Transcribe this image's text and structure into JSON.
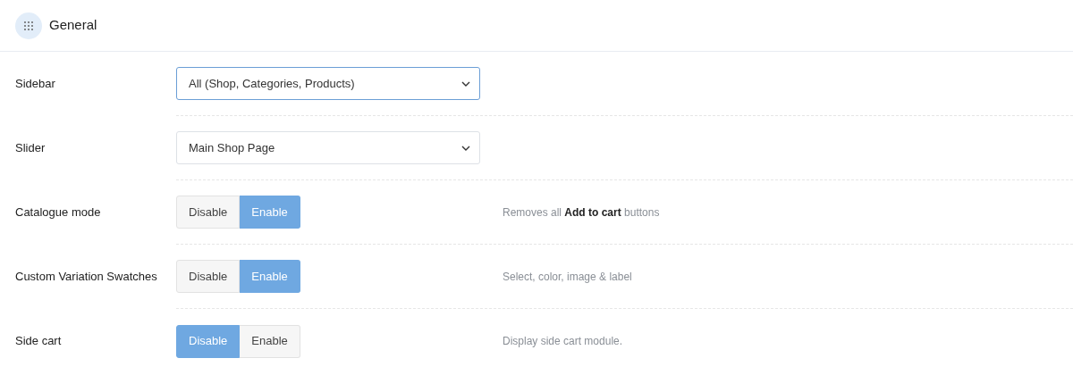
{
  "section": {
    "title": "General"
  },
  "settings": [
    {
      "label": "Sidebar",
      "kind": "select",
      "value": "All (Shop, Categories, Products)",
      "focused": true
    },
    {
      "label": "Slider",
      "kind": "select",
      "value": "Main Shop Page",
      "focused": false
    },
    {
      "label": "Catalogue mode",
      "kind": "toggle",
      "options": [
        {
          "label": "Disable",
          "selected": false
        },
        {
          "label": "Enable",
          "selected": true
        }
      ],
      "description": "Removes all **Add to cart** buttons"
    },
    {
      "label": "Custom Variation Swatches",
      "kind": "toggle",
      "options": [
        {
          "label": "Disable",
          "selected": false
        },
        {
          "label": "Enable",
          "selected": true
        }
      ],
      "description": "Select, color, image & label"
    },
    {
      "label": "Side cart",
      "kind": "toggle",
      "options": [
        {
          "label": "Disable",
          "selected": true
        },
        {
          "label": "Enable",
          "selected": false
        }
      ],
      "description": "Display side cart module."
    }
  ]
}
